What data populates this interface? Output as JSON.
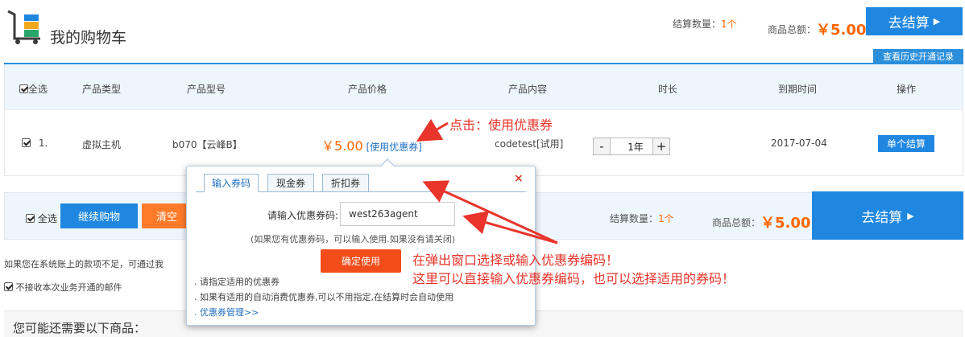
{
  "header": {
    "title": "我的购物车",
    "count_label": "结算数量：",
    "count_value": "1个",
    "total_label": "商品总额：",
    "total_value": "￥5.00",
    "checkout_label": "去结算",
    "history_label": "查看历史开通记录"
  },
  "table": {
    "select_all": "全选",
    "columns": [
      "产品类型",
      "产品型号",
      "产品价格",
      "产品内容",
      "时长",
      "到期时间",
      "操作"
    ],
    "row": {
      "index": "1.",
      "type": "虚拟主机",
      "model": "b070【云峰B】",
      "price": "￥5.00",
      "coupon_link": "[使用优惠券]",
      "content": "codetest[试用]",
      "qty_minus": "-",
      "duration": "1年",
      "qty_plus": "+",
      "expire": "2017-07-04",
      "action": "单个结算"
    }
  },
  "bottom": {
    "select_all": "全选",
    "continue_label": "继续购物",
    "clear_label": "清空",
    "count_label": "结算数量：",
    "count_value": "1个",
    "total_label": "商品总额：",
    "total_value": "￥5.00",
    "checkout_label": "去结算"
  },
  "notice_text": "如果您在系统账上的款项不足，可通过我",
  "mail_option": "不接收本次业务开通的邮件",
  "maybe_title": "您可能还需要以下商品：",
  "popup": {
    "tabs": [
      "输入券码",
      "现金券",
      "折扣券"
    ],
    "close": "×",
    "code_label": "请输入优惠券码:",
    "code_value": "west263agent",
    "hint": "(如果您有优惠券码，可以输入使用.如果没有请关闭)",
    "confirm": "确定使用",
    "notes": [
      ". 请指定适用的优惠券",
      ". 如果有适用的自动消费优惠券,可以不用指定,在结算时会自动使用"
    ],
    "manage_link": ". 优惠券管理>>"
  },
  "annotations": {
    "click": "点击：使用优惠券",
    "line1": "在弹出窗口选择或输入优惠券编码！",
    "line2": "这里可以直接输入优惠券编码，也可以选择适用的券码！"
  },
  "colors": {
    "primary": "#1f87e0",
    "price": "#ff6600",
    "confirm": "#f24c1a",
    "annotation": "#e8342a"
  }
}
